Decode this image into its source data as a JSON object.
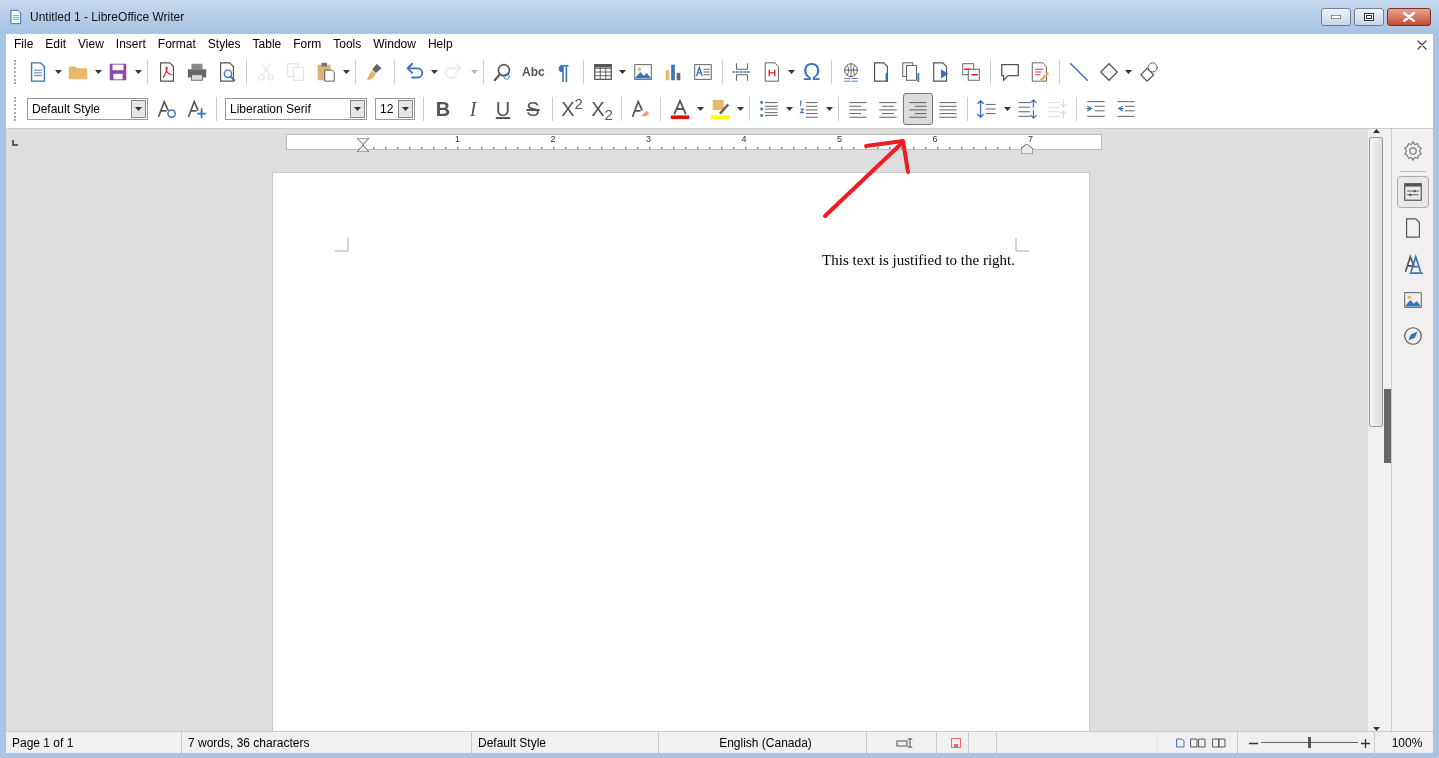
{
  "window": {
    "title": "Untitled 1 - LibreOffice Writer"
  },
  "menu": [
    "File",
    "Edit",
    "View",
    "Insert",
    "Format",
    "Styles",
    "Table",
    "Form",
    "Tools",
    "Window",
    "Help"
  ],
  "toolbar_standard": [
    {
      "kind": "button",
      "dropdown": true,
      "disabled": false
    },
    {
      "kind": "button",
      "dropdown": true,
      "disabled": false
    },
    {
      "kind": "button",
      "dropdown": true,
      "disabled": false
    },
    {
      "kind": "separator"
    },
    {
      "kind": "button",
      "disabled": false
    },
    {
      "kind": "button",
      "disabled": false
    },
    {
      "kind": "button",
      "disabled": false
    },
    {
      "kind": "separator"
    },
    {
      "kind": "button",
      "disabled": true
    },
    {
      "kind": "button",
      "disabled": true
    },
    {
      "kind": "button",
      "dropdown": true,
      "disabled": false
    },
    {
      "kind": "separator"
    },
    {
      "kind": "button",
      "disabled": false
    },
    {
      "kind": "separator"
    },
    {
      "kind": "button",
      "dropdown": true,
      "disabled": false
    },
    {
      "kind": "button",
      "dropdown": true,
      "disabled": true
    },
    {
      "kind": "separator"
    },
    {
      "kind": "button",
      "disabled": false
    },
    {
      "kind": "glyph",
      "label": "Abc",
      "disabled": false
    },
    {
      "kind": "glyph",
      "label": "¶",
      "disabled": false
    },
    {
      "kind": "separator"
    },
    {
      "kind": "button",
      "dropdown": true,
      "disabled": false
    },
    {
      "kind": "button",
      "disabled": false
    },
    {
      "kind": "button",
      "disabled": false
    },
    {
      "kind": "button",
      "disabled": false
    },
    {
      "kind": "separator"
    },
    {
      "kind": "button",
      "disabled": false
    },
    {
      "kind": "button",
      "dropdown": true,
      "disabled": false
    },
    {
      "kind": "glyph",
      "label": "Ω",
      "disabled": false
    },
    {
      "kind": "separator"
    },
    {
      "kind": "button",
      "disabled": false
    },
    {
      "kind": "button",
      "disabled": false
    },
    {
      "kind": "button",
      "disabled": false
    },
    {
      "kind": "button",
      "disabled": false
    },
    {
      "kind": "button",
      "disabled": false
    },
    {
      "kind": "separator"
    },
    {
      "kind": "button",
      "disabled": false
    },
    {
      "kind": "button",
      "disabled": false
    },
    {
      "kind": "separator"
    },
    {
      "kind": "button",
      "disabled": false
    },
    {
      "kind": "button",
      "dropdown": true,
      "disabled": false
    },
    {
      "kind": "button",
      "disabled": false
    }
  ],
  "toolbar_formatting": [
    {
      "kind": "combo",
      "value": "Default Style"
    },
    {
      "kind": "button",
      "disabled": false,
      "selected": false
    },
    {
      "kind": "button",
      "disabled": false,
      "selected": false
    },
    {
      "kind": "separator"
    },
    {
      "kind": "combo",
      "value": "Liberation Serif"
    },
    {
      "kind": "combo",
      "value": "12"
    },
    {
      "kind": "separator"
    },
    {
      "kind": "glyph",
      "label": "B",
      "disabled": false,
      "selected": false
    },
    {
      "kind": "glyph",
      "label": "I",
      "disabled": false,
      "selected": false
    },
    {
      "kind": "glyph",
      "label": "U",
      "disabled": false,
      "selected": false
    },
    {
      "kind": "glyph",
      "label": "S",
      "disabled": false,
      "selected": false
    },
    {
      "kind": "separator"
    },
    {
      "kind": "glyph",
      "label": "X$^{2}$",
      "disabled": false,
      "selected": false
    },
    {
      "kind": "glyph",
      "label": "X$_{2}$",
      "disabled": false,
      "selected": false
    },
    {
      "kind": "separator"
    },
    {
      "kind": "button",
      "disabled": false,
      "selected": false
    },
    {
      "kind": "separator"
    },
    {
      "kind": "button",
      "dropdown": true,
      "disabled": false,
      "selected": false
    },
    {
      "kind": "button",
      "dropdown": true,
      "disabled": false,
      "selected": false
    },
    {
      "kind": "separator"
    },
    {
      "kind": "button",
      "dropdown": true,
      "disabled": false,
      "selected": false
    },
    {
      "kind": "button",
      "dropdown": true,
      "disabled": false,
      "selected": false
    },
    {
      "kind": "separator"
    },
    {
      "kind": "button",
      "disabled": false,
      "selected": false
    },
    {
      "kind": "button",
      "disabled": false,
      "selected": false
    },
    {
      "kind": "button",
      "disabled": false,
      "selected": true
    },
    {
      "kind": "button",
      "disabled": false,
      "selected": false
    },
    {
      "kind": "separator"
    },
    {
      "kind": "button",
      "dropdown": true,
      "disabled": false,
      "selected": false
    },
    {
      "kind": "button",
      "disabled": false,
      "selected": false
    },
    {
      "kind": "button",
      "disabled": true,
      "selected": false
    },
    {
      "kind": "separator"
    },
    {
      "kind": "button",
      "disabled": false,
      "selected": false
    },
    {
      "kind": "button",
      "disabled": false,
      "selected": false
    }
  ],
  "ruler": {
    "numbers": [
      "1",
      "2",
      "3",
      "4",
      "5",
      "6",
      "7"
    ]
  },
  "document": {
    "paragraphs": [
      "This text is justified to the right."
    ]
  },
  "sidebar": {
    "tabs": [
      {
        "selected": true
      },
      {
        "selected": false
      },
      {
        "selected": false
      },
      {
        "selected": false
      },
      {
        "selected": false
      }
    ]
  },
  "status_bar": {
    "page": "Page 1 of 1",
    "words": "7 words, 36 characters",
    "style": "Default Style",
    "language": "English (Canada)",
    "zoom": {
      "level": 0.49,
      "reading": "100%"
    }
  }
}
